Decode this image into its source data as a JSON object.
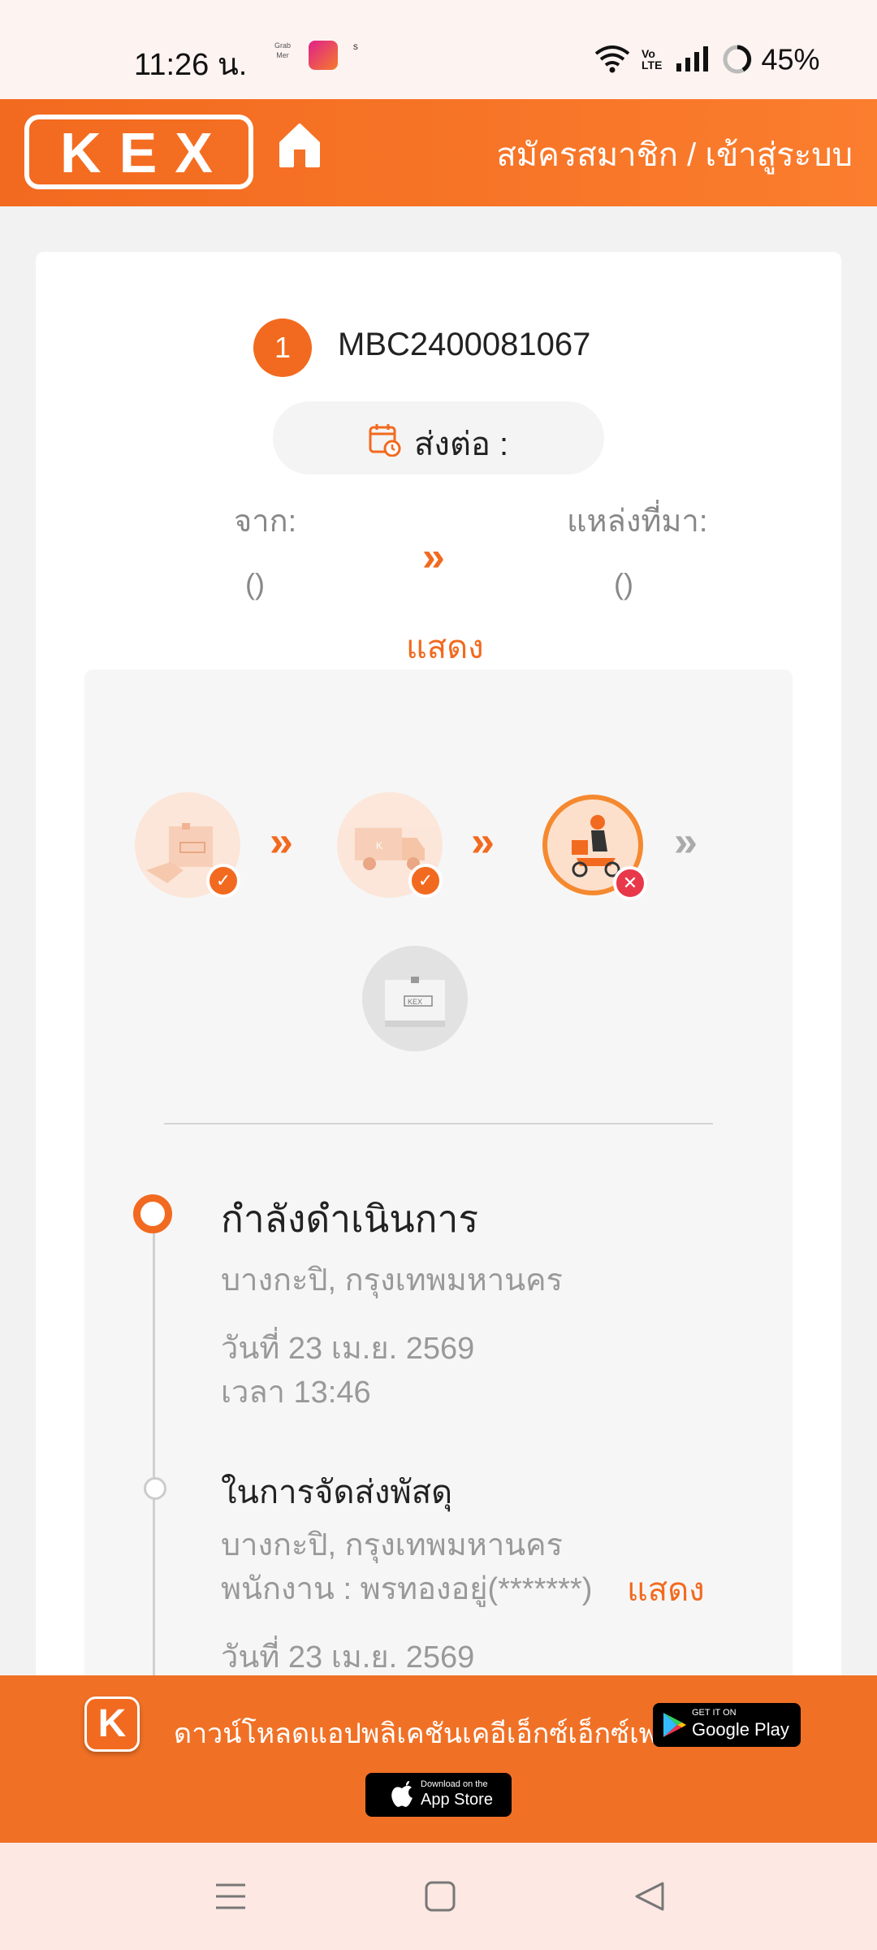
{
  "status_bar": {
    "time": "11:26 น.",
    "app_icons": [
      "grab-merchant-icon",
      "lazada-icon",
      "shopee-icon"
    ],
    "battery": "45%"
  },
  "header": {
    "logo_text": "KEX",
    "login_link": "สมัครสมาชิก / เข้าสู่ระบบ"
  },
  "shipment": {
    "index": "1",
    "tracking_number": "MBC2400081067",
    "forward_label": "ส่งต่อ :",
    "from_label": "จาก:",
    "from_value": "()",
    "source_label": "แหล่งที่มา:",
    "source_value": "()",
    "show_label": "แสดง"
  },
  "progress": {
    "steps": [
      {
        "name": "pickup",
        "status": "done",
        "badge": "✓"
      },
      {
        "name": "transit",
        "status": "done",
        "badge": "✓"
      },
      {
        "name": "delivery",
        "status": "failed",
        "badge": "✕"
      },
      {
        "name": "delivered",
        "status": "pending"
      }
    ],
    "chevron": "»",
    "box_label": "KEX"
  },
  "timeline": [
    {
      "title": "กำลังดำเนินการ",
      "location": "บางกะปิ, กรุงเทพมหานคร",
      "date": "วันที่ 23 เม.ย. 2569",
      "time": "เวลา 13:46"
    },
    {
      "title": "ในการจัดส่งพัสดุ",
      "location": "บางกะปิ, กรุงเทพมหานคร",
      "staff": "พนักงาน : พรทองอยู่(*******)",
      "show_label": "แสดง",
      "date": "วันที่ 23 เม.ย. 2569"
    }
  ],
  "banner": {
    "app_icon_letter": "K",
    "text": "ดาวน์โหลดแอปพลิเคชันเคอีเอ็กซ์เอ็กซ์เพรส",
    "google_play_small": "GET IT ON",
    "google_play_big": "Google Play",
    "app_store_small": "Download on the",
    "app_store_big": "App Store"
  },
  "colors": {
    "brand_orange": "#f26a1f",
    "error_red": "#e8384a"
  }
}
